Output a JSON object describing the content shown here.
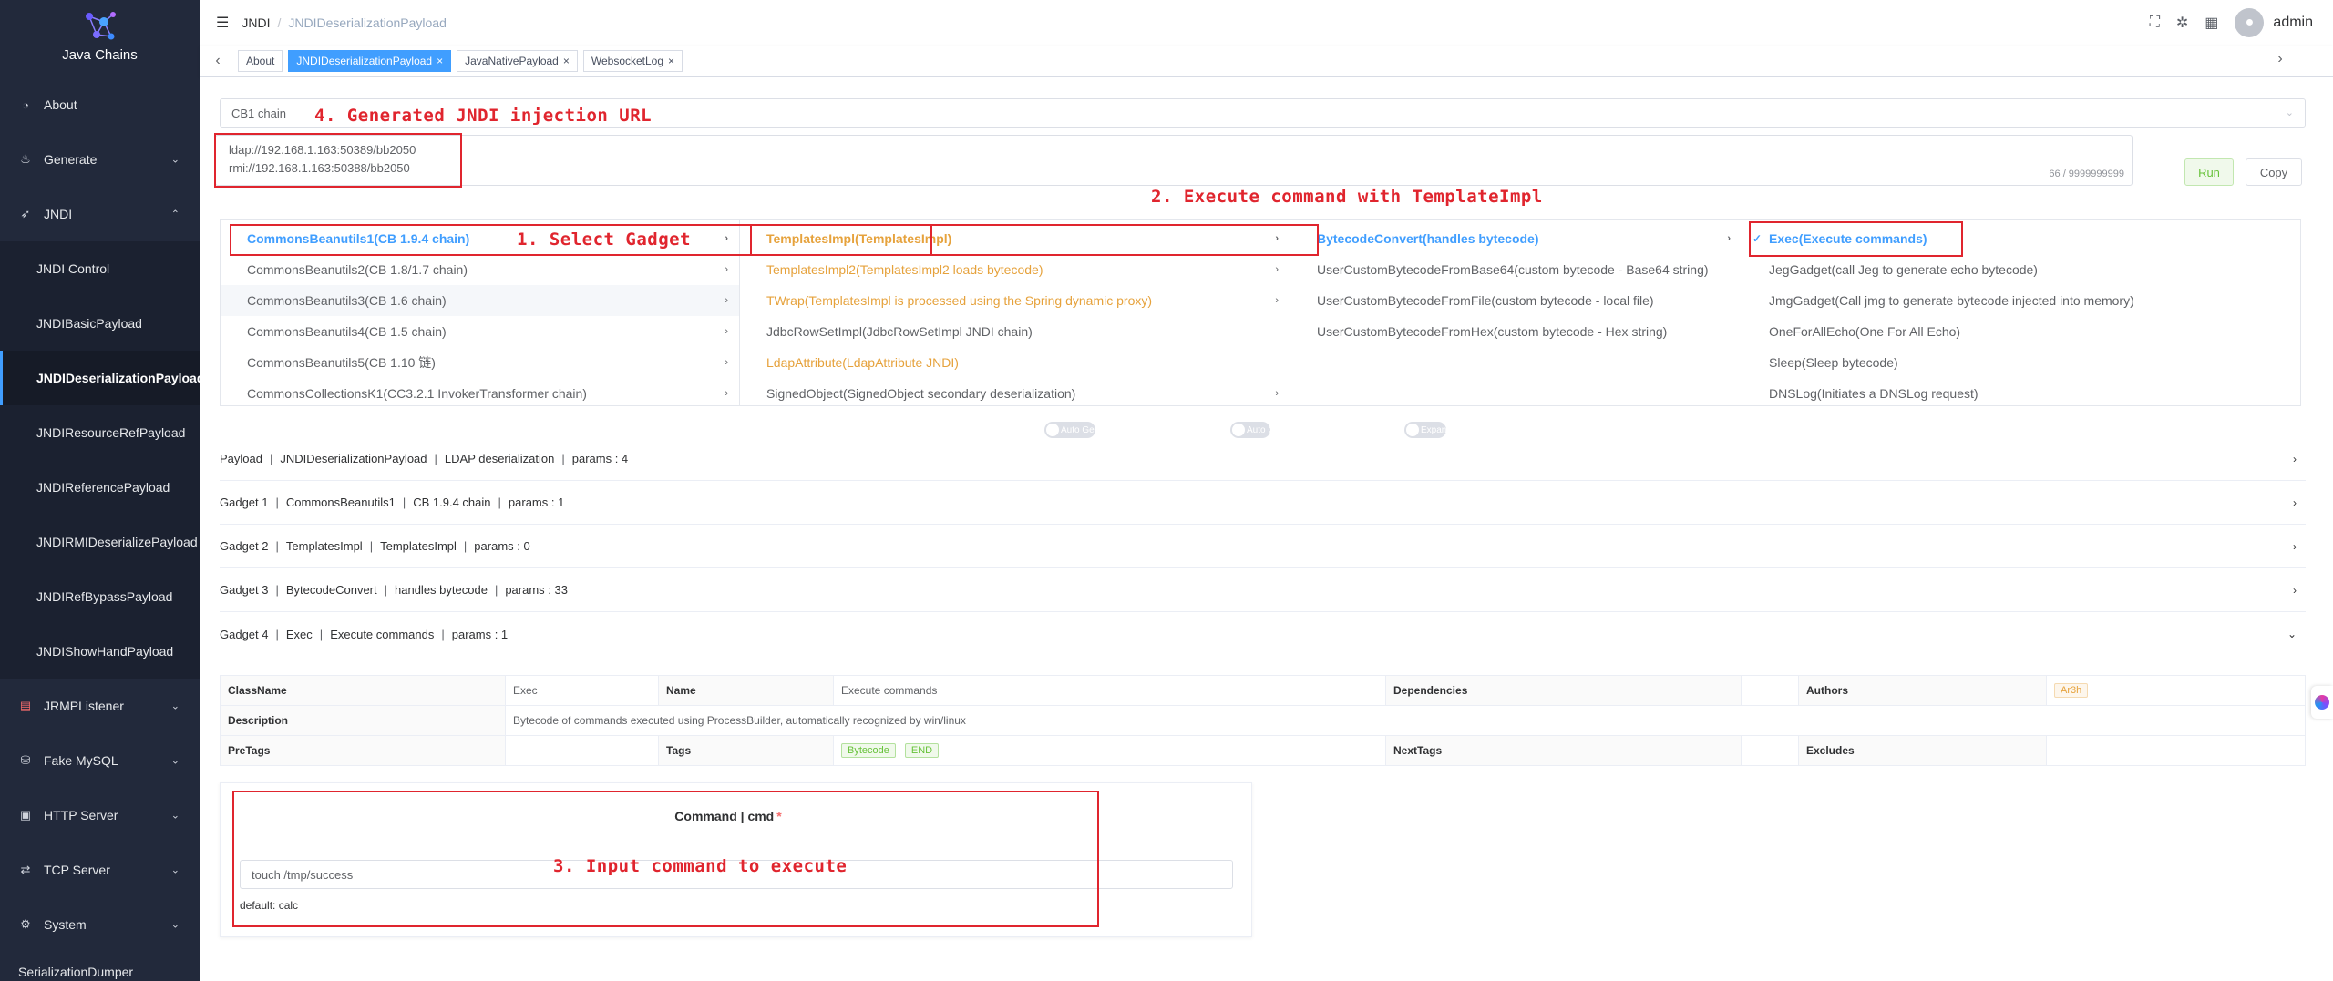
{
  "app": {
    "name": "Java Chains"
  },
  "sidebar": {
    "items": [
      {
        "label": "About",
        "icon": "dashboard-icon"
      },
      {
        "label": "Generate",
        "icon": "java-icon"
      },
      {
        "label": "JNDI",
        "icon": "rocket-icon"
      },
      {
        "label": "JRMPListener",
        "icon": "document-icon"
      },
      {
        "label": "Fake MySQL",
        "icon": "mysql-icon"
      },
      {
        "label": "HTTP Server",
        "icon": "server-icon"
      },
      {
        "label": "TCP Server",
        "icon": "tcp-icon"
      },
      {
        "label": "System",
        "icon": "gear-icon"
      },
      {
        "label": "SerializationDumper",
        "icon": ""
      }
    ],
    "jndi_children": [
      "JNDI Control",
      "JNDIBasicPayload",
      "JNDIDeserializationPayload",
      "JNDIResourceRefPayload",
      "JNDIReferencePayload",
      "JNDIRMIDeserializePayload",
      "JNDIRefBypassPayload",
      "JNDIShowHandPayload"
    ]
  },
  "header": {
    "breadcrumb": [
      "JNDI",
      "JNDIDeserializationPayload"
    ],
    "username": "admin"
  },
  "tags": [
    {
      "label": "About",
      "closable": false
    },
    {
      "label": "JNDIDeserializationPayload",
      "closable": true,
      "active": true
    },
    {
      "label": "JavaNativePayload",
      "closable": true
    },
    {
      "label": "WebsocketLog",
      "closable": true
    }
  ],
  "chain_select": {
    "value": "CB1 chain"
  },
  "url_box": {
    "lines": [
      "ldap://192.168.1.163:50389/bb2050",
      "rmi://192.168.1.163:50388/bb2050"
    ],
    "count": "66 / 9999999999"
  },
  "buttons": {
    "run": "Run",
    "copy": "Copy"
  },
  "cascader": {
    "col1": [
      "CommonsBeanutils1(CB 1.9.4 chain)",
      "CommonsBeanutils2(CB 1.8/1.7 chain)",
      "CommonsBeanutils3(CB 1.6 chain)",
      "CommonsBeanutils4(CB 1.5 chain)",
      "CommonsBeanutils5(CB 1.10 链)",
      "CommonsCollectionsK1(CC3.2.1 InvokerTransformer chain)"
    ],
    "col2": [
      "TemplatesImpl(TemplatesImpl)",
      "TemplatesImpl2(TemplatesImpl2 loads bytecode)",
      "TWrap(TemplatesImpl is processed using the Spring dynamic proxy)",
      "JdbcRowSetImpl(JdbcRowSetImpl JNDI chain)",
      "LdapAttribute(LdapAttribute JNDI)",
      "SignedObject(SignedObject secondary deserialization)"
    ],
    "col3": [
      "BytecodeConvert(handles bytecode)",
      "UserCustomBytecodeFromBase64(custom bytecode - Base64 string)",
      "UserCustomBytecodeFromFile(custom bytecode - local file)",
      "UserCustomBytecodeFromHex(custom bytecode - Hex string)"
    ],
    "col4": [
      "Exec(Execute commands)",
      "JegGadget(call Jeg to generate echo bytecode)",
      "JmgGadget(Call jmg to generate bytecode injected into memory)",
      "OneForAllEcho(One For All Echo)",
      "Sleep(Sleep bytecode)",
      "DNSLog(Initiates a DNSLog request)"
    ]
  },
  "switches": {
    "auto_generate": "Auto Generate",
    "auto_copy": "Auto Copy",
    "expand_all": "Expand All"
  },
  "collapse": [
    {
      "label": "Payload",
      "parts": [
        "JNDIDeserializationPayload",
        "LDAP deserialization",
        "params : 4"
      ]
    },
    {
      "label": "Gadget 1",
      "parts": [
        "CommonsBeanutils1",
        "CB 1.9.4 chain",
        "params : 1"
      ]
    },
    {
      "label": "Gadget 2",
      "parts": [
        "TemplatesImpl",
        "TemplatesImpl",
        "params : 0"
      ]
    },
    {
      "label": "Gadget 3",
      "parts": [
        "BytecodeConvert",
        "handles bytecode",
        "params : 33"
      ]
    },
    {
      "label": "Gadget 4",
      "parts": [
        "Exec",
        "Execute commands",
        "params : 1"
      ]
    }
  ],
  "details": {
    "labels": {
      "classname": "ClassName",
      "name": "Name",
      "dependencies": "Dependencies",
      "authors": "Authors",
      "description": "Description",
      "pretags": "PreTags",
      "tags": "Tags",
      "nexttags": "NextTags",
      "excludes": "Excludes"
    },
    "classname": "Exec",
    "name": "Execute commands",
    "author": "Ar3h",
    "description": "Bytecode of commands executed using ProcessBuilder, automatically recognized by win/linux",
    "tags": [
      "Bytecode",
      "END"
    ]
  },
  "command": {
    "title": "Command | cmd",
    "required_mark": "*",
    "value": "touch /tmp/success",
    "default": "default: calc"
  },
  "annotations": {
    "a1": "1. Select Gadget",
    "a2": "2. Execute command with TemplateImpl",
    "a3": "3. Input command to execute",
    "a4": "4. Generated JNDI injection URL"
  },
  "colors": {
    "sidebar_bg": "#22293b",
    "accent": "#409eff",
    "annotation": "#e0252e",
    "orange": "#e6a23c"
  }
}
